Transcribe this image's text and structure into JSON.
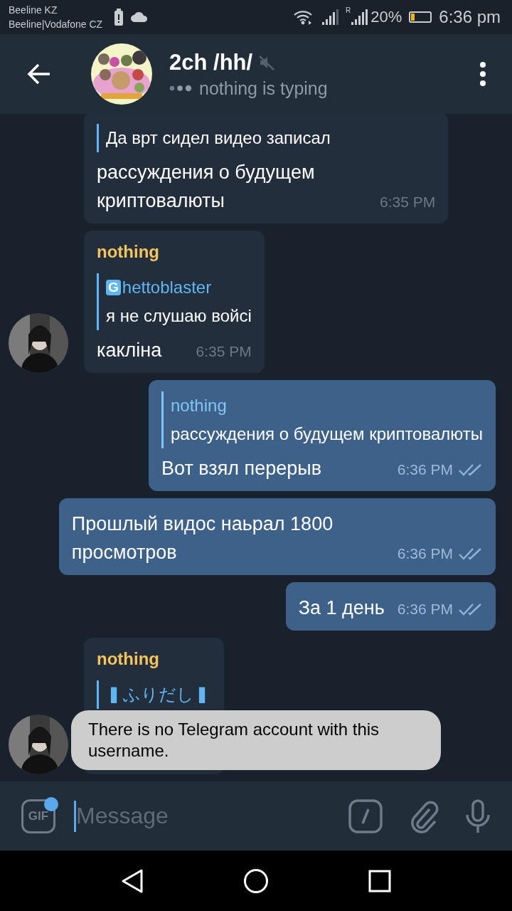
{
  "status_bar": {
    "carrier_1": "Beeline KZ",
    "carrier_2": "Beeline|Vodafone CZ",
    "roaming": "R",
    "battery": "20%",
    "time": "6:36 pm"
  },
  "header": {
    "title": "2ch /hh/",
    "muted": true,
    "status": "nothing is typing"
  },
  "messages": [
    {
      "kind": "incoming",
      "avatar": false,
      "quote": {
        "text": "Да врт сидел видео записал"
      },
      "text": "рассуждения о будущем криптовалюты",
      "time": "6:35 PM"
    },
    {
      "kind": "incoming",
      "avatar": true,
      "sender": "nothing",
      "quote": {
        "author": "Ghettoblaster",
        "text": "я не слушаю войсі"
      },
      "text": "какліна",
      "time": "6:35 PM"
    },
    {
      "kind": "outgoing",
      "quote": {
        "author": "nothing",
        "text": "рассуждения о будущем криптовалюты"
      },
      "text": "Вот взял перерыв",
      "time": "6:36 PM",
      "read": true
    },
    {
      "kind": "outgoing",
      "text": "Прошлый видос наьрал 1800 просмотров",
      "time": "6:36 PM",
      "read": true
    },
    {
      "kind": "outgoing",
      "text": "За 1 день",
      "time": "6:36 PM",
      "read": true
    },
    {
      "kind": "incoming",
      "avatar": true,
      "sender": "nothing",
      "quote": {
        "author": "▍ふりだし▍"
      }
    }
  ],
  "toast": "There is no Telegram account with this username.",
  "composer": {
    "gif": "GIF",
    "gif_badge": true,
    "placeholder": "Message"
  }
}
